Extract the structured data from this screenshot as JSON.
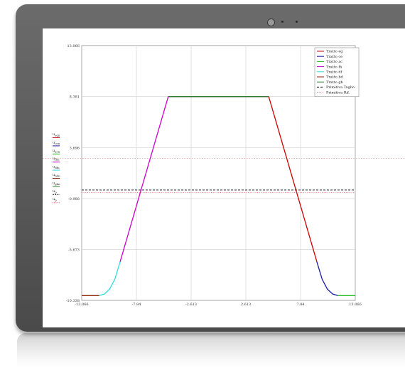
{
  "chart_data": {
    "type": "line",
    "title": "",
    "xlabel": "",
    "ylabel": "",
    "xlim": [
      -13.066,
      13.066
    ],
    "ylim": [
      -10.338,
      13.066
    ],
    "x_ticks": [
      "-13.066",
      "-7.84",
      "-2.613",
      "2.613",
      "7.84",
      "13.066"
    ],
    "x_tick_values": [
      -13.066,
      -7.84,
      -2.613,
      2.613,
      7.84,
      13.066
    ],
    "y_ticks": [
      "13.066",
      "8.381",
      "3.696",
      "-0.988",
      "-5.673",
      "-10.338"
    ],
    "y_tick_values": [
      13.066,
      8.381,
      3.696,
      -0.988,
      -5.673,
      -10.338
    ],
    "grid": true,
    "legend_position": "top-right",
    "y_axis_series_labels": [
      {
        "main": "u",
        "sub": "egn"
      },
      {
        "main": "u",
        "sub": "cen"
      },
      {
        "main": "u",
        "sub": "acn"
      },
      {
        "main": "u",
        "sub": "fhn"
      },
      {
        "main": "u",
        "sub": "dfn"
      },
      {
        "main": "u",
        "sub": "bdn"
      },
      {
        "main": "u",
        "sub": "ghn"
      },
      {
        "main": "u",
        "sub": "p"
      },
      {
        "main": "u",
        "sub": "p"
      }
    ],
    "series": [
      {
        "name": "Tratto eg",
        "color": "#cc0000",
        "dash": "solid",
        "x": [
          -4.8,
          4.8
        ],
        "y": [
          8.381,
          8.381
        ]
      },
      {
        "name": "Tratto eg",
        "color": "#cc0000",
        "dash": "solid",
        "x": [
          4.8,
          9.4
        ],
        "y": [
          8.381,
          -6.8
        ]
      },
      {
        "name": "Tratto ce",
        "color": "#1a1aa6",
        "dash": "solid",
        "x": [
          9.4,
          9.9,
          10.4,
          10.9,
          11.4
        ],
        "y": [
          -6.8,
          -8.4,
          -9.3,
          -9.75,
          -9.9
        ]
      },
      {
        "name": "Tratto ac",
        "color": "#22bb22",
        "dash": "solid",
        "x": [
          11.4,
          13.066
        ],
        "y": [
          -9.9,
          -9.9
        ]
      },
      {
        "name": "Tratto fh",
        "color": "#cc00cc",
        "dash": "solid",
        "x": [
          -9.4,
          -4.8
        ],
        "y": [
          -6.8,
          8.381
        ]
      },
      {
        "name": "Tratto df",
        "color": "#33dddd",
        "dash": "solid",
        "x": [
          -11.4,
          -10.9,
          -10.4,
          -9.9,
          -9.4
        ],
        "y": [
          -9.9,
          -9.75,
          -9.3,
          -8.4,
          -6.8
        ]
      },
      {
        "name": "Tratto bd",
        "color": "#8b2500",
        "dash": "solid",
        "x": [
          -13.066,
          -11.4
        ],
        "y": [
          -9.9,
          -9.9
        ]
      },
      {
        "name": "Tratto gh",
        "color": "#2e7d32",
        "dash": "solid",
        "x": [
          -4.8,
          4.8
        ],
        "y": [
          8.38,
          8.38
        ]
      },
      {
        "name": "Primitiva Taglio",
        "color": "#111111",
        "dash": "dash",
        "x": [
          -13.066,
          13.066
        ],
        "y": [
          -0.2,
          -0.2
        ]
      },
      {
        "name": "Primitiva Rif.",
        "color": "#e06060",
        "dash": "dot",
        "x": [
          -13.066,
          13.066
        ],
        "y": [
          -0.45,
          -0.45
        ]
      }
    ],
    "extra_reference": {
      "color": "#e08a8a",
      "y": 2.7
    }
  }
}
